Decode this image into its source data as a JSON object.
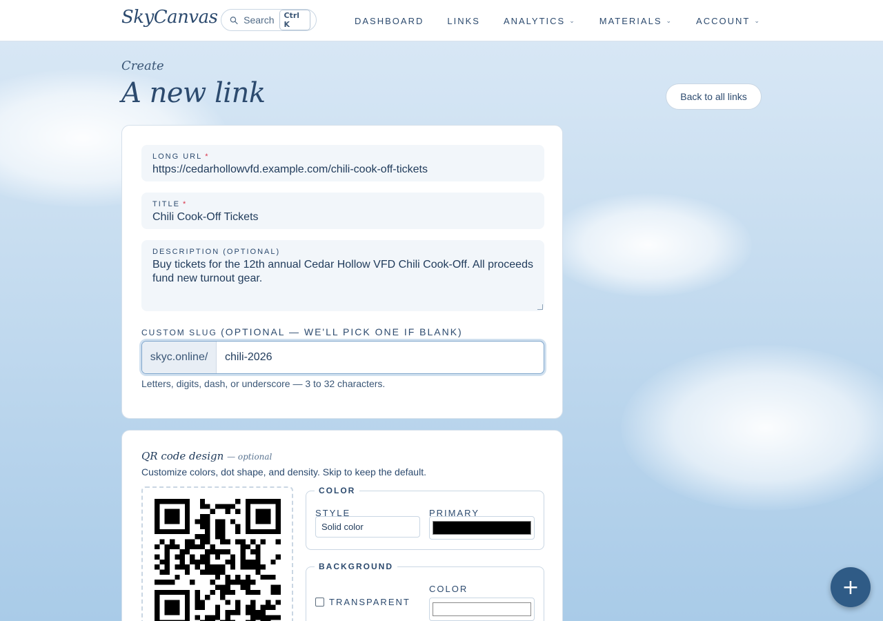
{
  "header": {
    "logo": "SkyCanvas",
    "search": {
      "placeholder": "Search",
      "shortcut": "Ctrl K"
    },
    "nav": [
      {
        "label": "DASHBOARD",
        "dropdown": false
      },
      {
        "label": "LINKS",
        "dropdown": false
      },
      {
        "label": "ANALYTICS",
        "dropdown": true
      },
      {
        "label": "MATERIALS",
        "dropdown": true
      },
      {
        "label": "ACCOUNT",
        "dropdown": true
      }
    ]
  },
  "page": {
    "eyebrow": "Create",
    "title": "A new link",
    "back_label": "Back to all links"
  },
  "form": {
    "long_url": {
      "label": "LONG URL",
      "required_mark": "*",
      "value": "https://cedarhollowvfd.example.com/chili-cook-off-tickets"
    },
    "title": {
      "label": "TITLE",
      "required_mark": "*",
      "value": "Chili Cook-Off Tickets"
    },
    "description": {
      "label": "DESCRIPTION (OPTIONAL)",
      "value": "Buy tickets for the 12th annual Cedar Hollow VFD Chili Cook-Off. All proceeds fund new turnout gear."
    },
    "slug": {
      "label": "CUSTOM SLUG",
      "label_optional": "(OPTIONAL — WE'LL PICK ONE IF BLANK)",
      "prefix": "skyc.online/",
      "value": "chili-2026",
      "hint": "Letters, digits, dash, or underscore — 3 to 32 characters."
    }
  },
  "qr": {
    "title": "QR code design",
    "title_sub": "— optional",
    "description": "Customize colors, dot shape, and density. Skip to keep the default.",
    "color_section": {
      "legend": "COLOR",
      "style_label": "STYLE",
      "style_value": "Solid color",
      "primary_label": "PRIMARY",
      "primary_color": "#000000"
    },
    "background_section": {
      "legend": "BACKGROUND",
      "transparent_label": "TRANSPARENT",
      "color_label": "COLOR",
      "color_value": "#ffffff"
    }
  },
  "fab": {
    "label": "+"
  }
}
